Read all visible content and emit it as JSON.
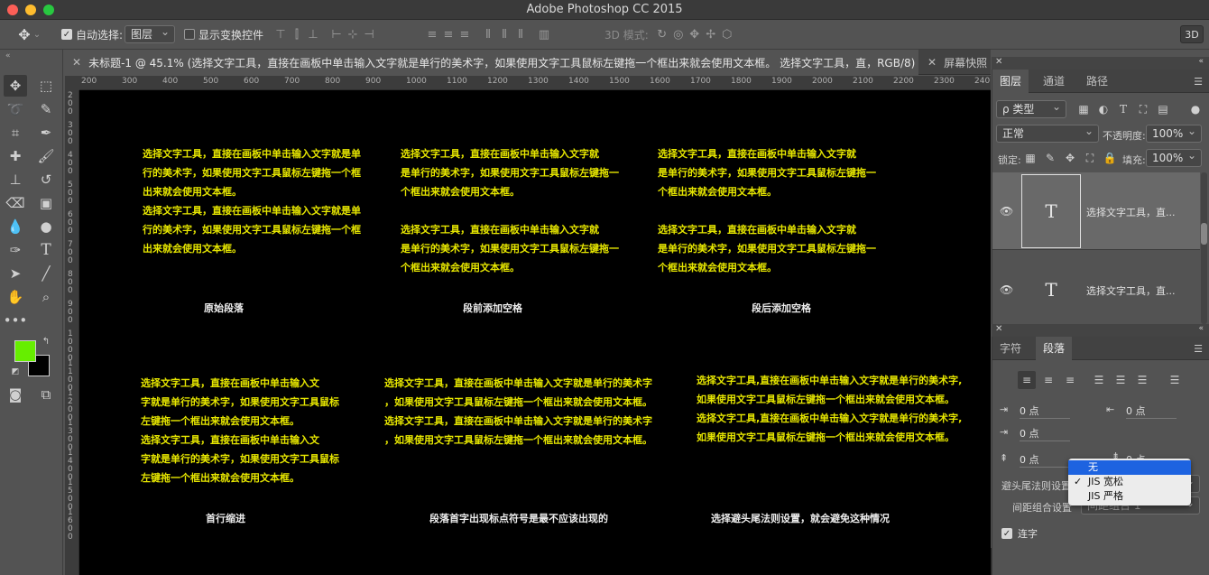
{
  "app": {
    "window_title": "Adobe Photoshop CC 2015"
  },
  "options_bar": {
    "auto_select_label": "自动选择:",
    "auto_select_value": "图层",
    "show_transform_label": "显示变换控件",
    "mode_3d_label": "3D 模式:",
    "btn_3d": "3D"
  },
  "document_tabs": {
    "active": "未标题-1 @ 45.1% (选择文字工具，直接在画板中单击输入文字就是单行的美术字，如果使用文字工具鼠标左键拖一个框出来就会使用文本框。 选择文字工具，直，RGB/8) *",
    "other": "屏幕快照"
  },
  "ruler": {
    "h_ticks": [
      "200",
      "300",
      "400",
      "500",
      "600",
      "700",
      "800",
      "900",
      "1000",
      "1100",
      "1200",
      "1300",
      "1400",
      "1500",
      "1600",
      "1700",
      "1800",
      "1900",
      "2000",
      "2100",
      "2200",
      "2300",
      "240"
    ],
    "v_ticks": [
      "200",
      "300",
      "400",
      "500",
      "600",
      "700",
      "800",
      "900",
      "1000",
      "1100",
      "1200",
      "1300",
      "1400",
      "1500",
      "1600"
    ]
  },
  "canvas": {
    "paragraphs": [
      {
        "text": "选择文字工具，直接在画板中单击输入文字就是单\n行的美术字，如果使用文字工具鼠标左键拖一个框\n出来就会使用文本框。\n选择文字工具，直接在画板中单击输入文字就是单\n行的美术字，如果使用文字工具鼠标左键拖一个框\n出来就会使用文本框。"
      },
      {
        "text": "    选择文字工具，直接在画板中单击输入文字就\n是单行的美术字，如果使用文字工具鼠标左键拖一\n个框出来就会使用文本框。\n\n    选择文字工具，直接在画板中单击输入文字就\n是单行的美术字，如果使用文字工具鼠标左键拖一\n个框出来就会使用文本框。"
      },
      {
        "text": "    选择文字工具，直接在画板中单击输入文字就\n是单行的美术字，如果使用文字工具鼠标左键拖一\n个框出来就会使用文本框。\n\n    选择文字工具，直接在画板中单击输入文字就\n是单行的美术字，如果使用文字工具鼠标左键拖一\n个框出来就会使用文本框。"
      },
      {
        "text": "    选择文字工具，直接在画板中单击输入文\n字就是单行的美术字，如果使用文字工具鼠标\n左键拖一个框出来就会使用文本框。\n    选择文字工具，直接在画板中单击输入文\n字就是单行的美术字，如果使用文字工具鼠标\n左键拖一个框出来就会使用文本框。"
      },
      {
        "text": "选择文字工具，直接在画板中单击输入文字就是单行的美术字\n，如果使用文字工具鼠标左键拖一个框出来就会使用文本框。\n选择文字工具，直接在画板中单击输入文字就是单行的美术字\n，如果使用文字工具鼠标左键拖一个框出来就会使用文本框。"
      },
      {
        "text": "选择文字工具,直接在画板中单击输入文字就是单行的美术字,\n如果使用文字工具鼠标左键拖一个框出来就会使用文本框。\n选择文字工具,直接在画板中单击输入文字就是单行的美术字,\n如果使用文字工具鼠标左键拖一个框出来就会使用文本框。"
      }
    ],
    "captions": [
      "原始段落",
      "段前添加空格",
      "段后添加空格",
      "首行缩进",
      "段落首字出现标点符号是最不应该出现的",
      "选择避头尾法则设置，就会避免这种情况"
    ]
  },
  "layers_panel": {
    "tabs": [
      "图层",
      "通道",
      "路径"
    ],
    "filter_label": "ρ 类型",
    "blend_mode": "正常",
    "opacity_label": "不透明度:",
    "opacity_value": "100%",
    "lock_label": "锁定:",
    "fill_label": "填充:",
    "fill_value": "100%",
    "layers": [
      {
        "thumb": "T",
        "name": "选择文字工具，直..."
      },
      {
        "thumb": "T",
        "name": "选择文字工具，直..."
      }
    ]
  },
  "paragraph_panel": {
    "tabs": [
      "字符",
      "段落"
    ],
    "indent_left": "0 点",
    "indent_right": "0 点",
    "indent_first": "0 点",
    "space_before": "0 点",
    "space_after": "0 点",
    "kinsoku_label": "避头尾法则设置",
    "mojikumi_label": "间距组合设置",
    "mojikumi_value": "间距组合 1",
    "hyphenate_label": "连字",
    "dropdown_options": [
      "无",
      "JIS 宽松",
      "JIS 严格"
    ]
  }
}
